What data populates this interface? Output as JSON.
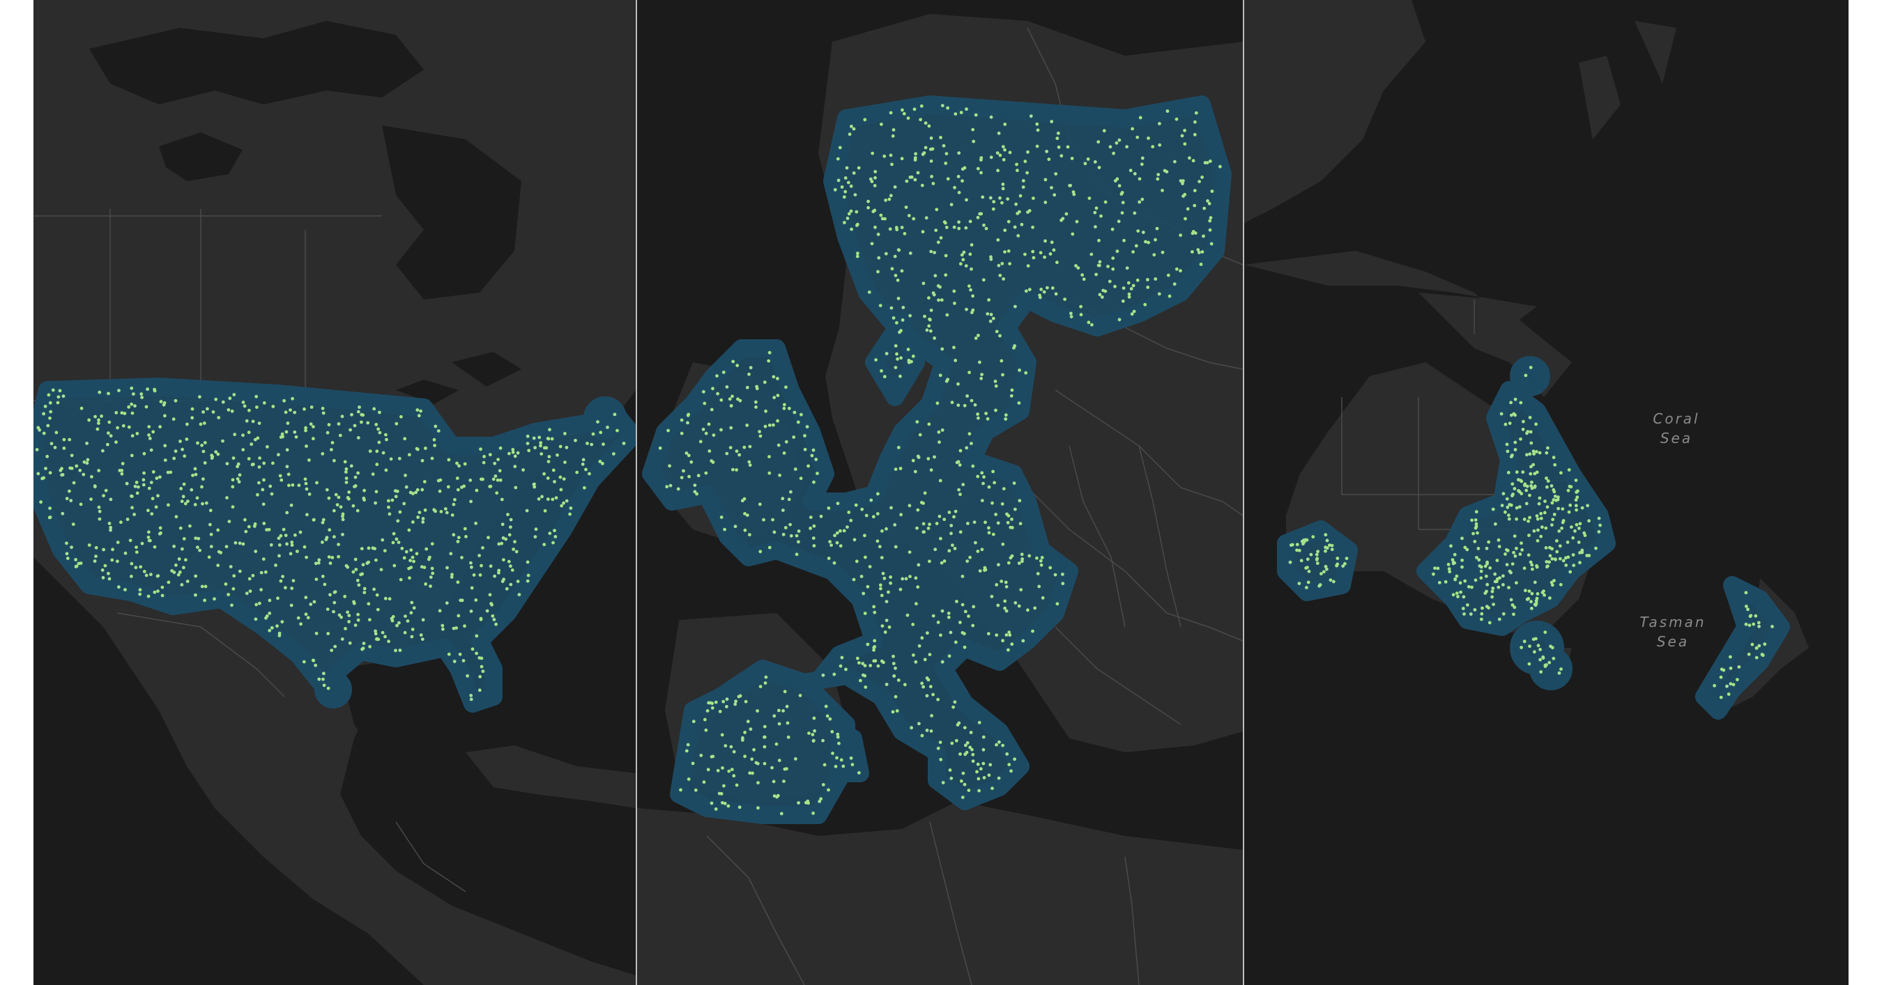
{
  "maps": [
    {
      "id": "north-america",
      "region": "Contiguous United States"
    },
    {
      "id": "europe",
      "region": "Europe"
    },
    {
      "id": "oceania",
      "region": "Australia and New Zealand"
    }
  ],
  "labels": {
    "coral_sea_1": "Coral",
    "coral_sea_2": "Sea",
    "tasman_sea_1": "Tasman",
    "tasman_sea_2": "Sea"
  },
  "colors": {
    "background": "#1b1b1b",
    "land": "#2c2c2c",
    "border": "#4a4a4a",
    "coverage": "#1d4a63",
    "point": "#a6e38a"
  }
}
